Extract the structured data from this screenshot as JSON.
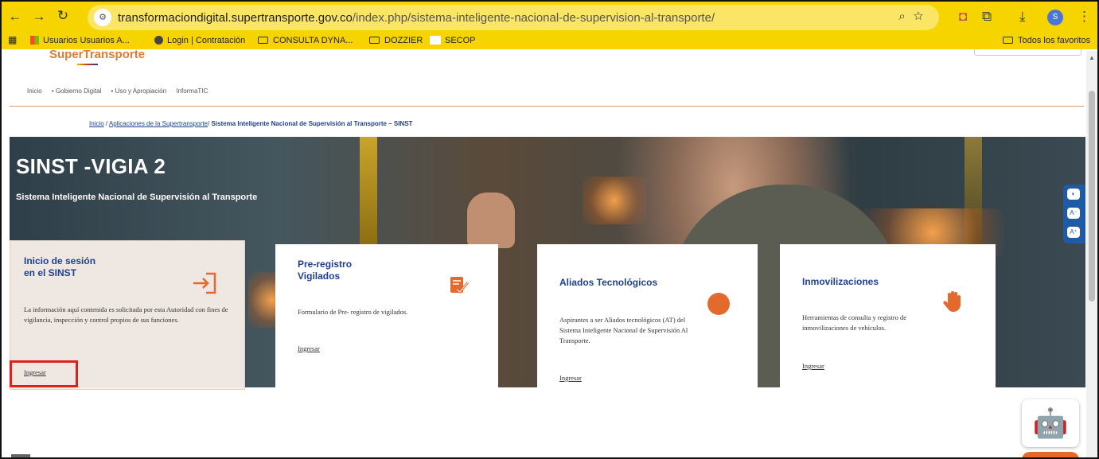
{
  "browser": {
    "url_host": "transformaciondigital.supertransporte.gov.co",
    "url_path": "/index.php/sistema-inteligente-nacional-de-supervision-al-transporte/",
    "avatar_letter": "S"
  },
  "bookmarks": {
    "items": [
      "Usuarios Usuarios A...",
      "Login | Contratación",
      "CONSULTA DYNA...",
      "DOZZIER",
      "SECOP"
    ],
    "all_label": "Todos los favoritos"
  },
  "site": {
    "logo": "SuperTransporte",
    "nav": [
      "Inicio",
      "• Gobierno Digital",
      "• Uso y Apropiación",
      "InformaTIC"
    ]
  },
  "breadcrumb": {
    "home": "Inicio",
    "sep1": " / ",
    "apps": "Aplicaciones de la Supertransporte",
    "sep2": "/ ",
    "current": "Sistema Inteligente Nacional de Supervisión al Transporte – SINST"
  },
  "hero": {
    "title": "SINST -VIGIA 2",
    "subtitle": "Sistema Inteligente Nacional de Supervisión al Transporte"
  },
  "cards": [
    {
      "title_line1": "Inicio de sesión",
      "title_line2": "en el SINST",
      "text": "La información aquí contenida es solicitada por esta Autoridad con fines de vigilancia, inspección y control propios de sus funciones.",
      "link": "Ingresar",
      "icon": "login-icon"
    },
    {
      "title_line1": "Pre-registro",
      "title_line2": "Vigilados",
      "text": "Formulario de Pre- registro de vigilados.",
      "link": "Ingresar",
      "icon": "form-edit-icon"
    },
    {
      "title_line1": "Aliados Tecnológicos",
      "text": "Aspirantes a ser Aliados tecnológicos (AT) del Sistema Inteligente Nacional de Supervisión Al Transporte.",
      "link": "Ingresar",
      "icon": "plus-circle-icon"
    },
    {
      "title_line1": "Inmovilizaciones",
      "text": "Herramientas de consulta y registro de inmovilizaciones de vehículos.",
      "link": "Ingresar",
      "icon": "hand-stop-icon"
    }
  ],
  "colors": {
    "accent": "#e36a2c",
    "brand_blue": "#1f3f91",
    "browser_bar": "#f5d400",
    "highlight": "#e0201b"
  }
}
